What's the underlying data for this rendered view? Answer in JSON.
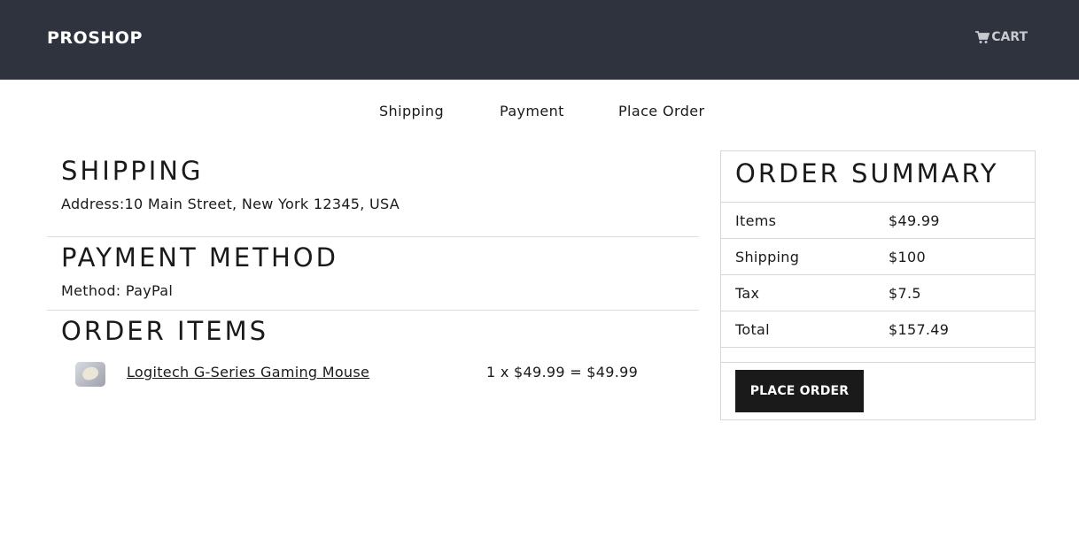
{
  "header": {
    "brand": "PROSHOP",
    "cart_label": "CART",
    "cart_icon": "shopping-cart-icon"
  },
  "steps": [
    "Shipping",
    "Payment",
    "Place Order"
  ],
  "shipping": {
    "title": "SHIPPING",
    "address_text": "Address:10 Main Street, New York 12345, USA"
  },
  "payment": {
    "title": "PAYMENT METHOD",
    "method_text": "Method: PayPal"
  },
  "order_items": {
    "title": "ORDER ITEMS",
    "items": [
      {
        "name": "Logitech G-Series Gaming Mouse",
        "price_text": "1 x $49.99 = $49.99"
      }
    ]
  },
  "summary": {
    "title": "ORDER SUMMARY",
    "rows": [
      {
        "label": "Items",
        "value": "$49.99"
      },
      {
        "label": "Shipping",
        "value": "$100"
      },
      {
        "label": "Tax",
        "value": "$7.5"
      },
      {
        "label": "Total",
        "value": "$157.49"
      }
    ],
    "button_label": "PLACE ORDER"
  },
  "colors": {
    "navbar_bg": "#2f333d",
    "button_bg": "#1a1a1a"
  }
}
